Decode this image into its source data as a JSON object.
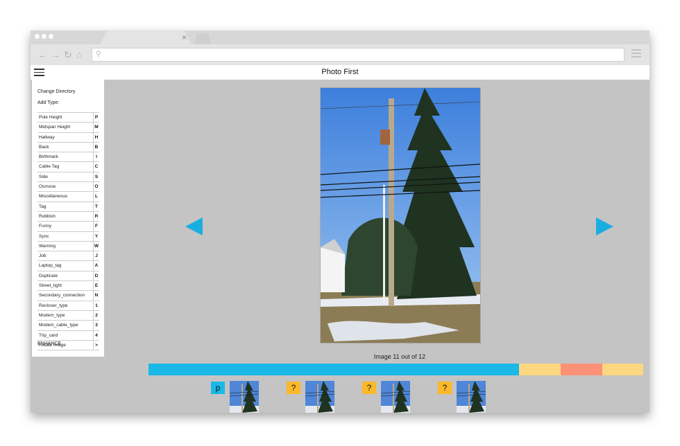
{
  "browser": {
    "tab_close": "×",
    "nav": {
      "back": "←",
      "forward": "→",
      "reload": "↻",
      "home": "⌂"
    },
    "search_glyph": "⚲",
    "url": ""
  },
  "app": {
    "title": "Photo First"
  },
  "sidebar": {
    "change_directory": "Change Directory",
    "add_type": "Add Type:",
    "types": [
      {
        "name": "Pole Height",
        "key": "P"
      },
      {
        "name": "Midspan Height",
        "key": "M"
      },
      {
        "name": "Hallway",
        "key": "H"
      },
      {
        "name": "Back",
        "key": "B"
      },
      {
        "name": "Birthmark",
        "key": "I"
      },
      {
        "name": "Cable Tag",
        "key": "C"
      },
      {
        "name": "Side",
        "key": "S"
      },
      {
        "name": "Osmose",
        "key": "O"
      },
      {
        "name": "Miscellaneous",
        "key": "L"
      },
      {
        "name": "Tag",
        "key": "T"
      },
      {
        "name": "Rubbish",
        "key": "R"
      },
      {
        "name": "Funny",
        "key": "F"
      },
      {
        "name": "Sync",
        "key": "Y"
      },
      {
        "name": "Warning",
        "key": "W"
      },
      {
        "name": "Job",
        "key": "J"
      },
      {
        "name": "Laptop_tag",
        "key": "A"
      },
      {
        "name": "Duplicate",
        "key": "D"
      },
      {
        "name": "Street_light",
        "key": "E"
      },
      {
        "name": "Secondary_connection",
        "key": "N"
      },
      {
        "name": "Recloser_type",
        "key": "1"
      },
      {
        "name": "Modem_type",
        "key": "2"
      },
      {
        "name": "Modem_cable_type",
        "key": "3"
      },
      {
        "name": "Trip_card",
        "key": "4"
      },
      {
        "name": "Rotate Image",
        "key": ">"
      }
    ],
    "enhance": "ENHANCE"
  },
  "viewer": {
    "counter": "Image 11 out of 12",
    "current_index": 11,
    "total": 12
  },
  "progress": {
    "segments": [
      {
        "fraction": 0.749,
        "color": "#1ab8e6"
      },
      {
        "fraction": 0.084,
        "color": "#fdd680"
      },
      {
        "fraction": 0.084,
        "color": "#fc9177"
      },
      {
        "fraction": 0.083,
        "color": "#fdd680"
      }
    ]
  },
  "thumbnails": [
    {
      "tag": "p",
      "tag_color": "#1ab8e6"
    },
    {
      "tag": "?",
      "tag_color": "#fbb828"
    },
    {
      "tag": "?",
      "tag_color": "#fbb828"
    },
    {
      "tag": "?",
      "tag_color": "#fbb828"
    }
  ],
  "colors": {
    "accent": "#1aaee0",
    "canvas": "#c4c4c4"
  }
}
